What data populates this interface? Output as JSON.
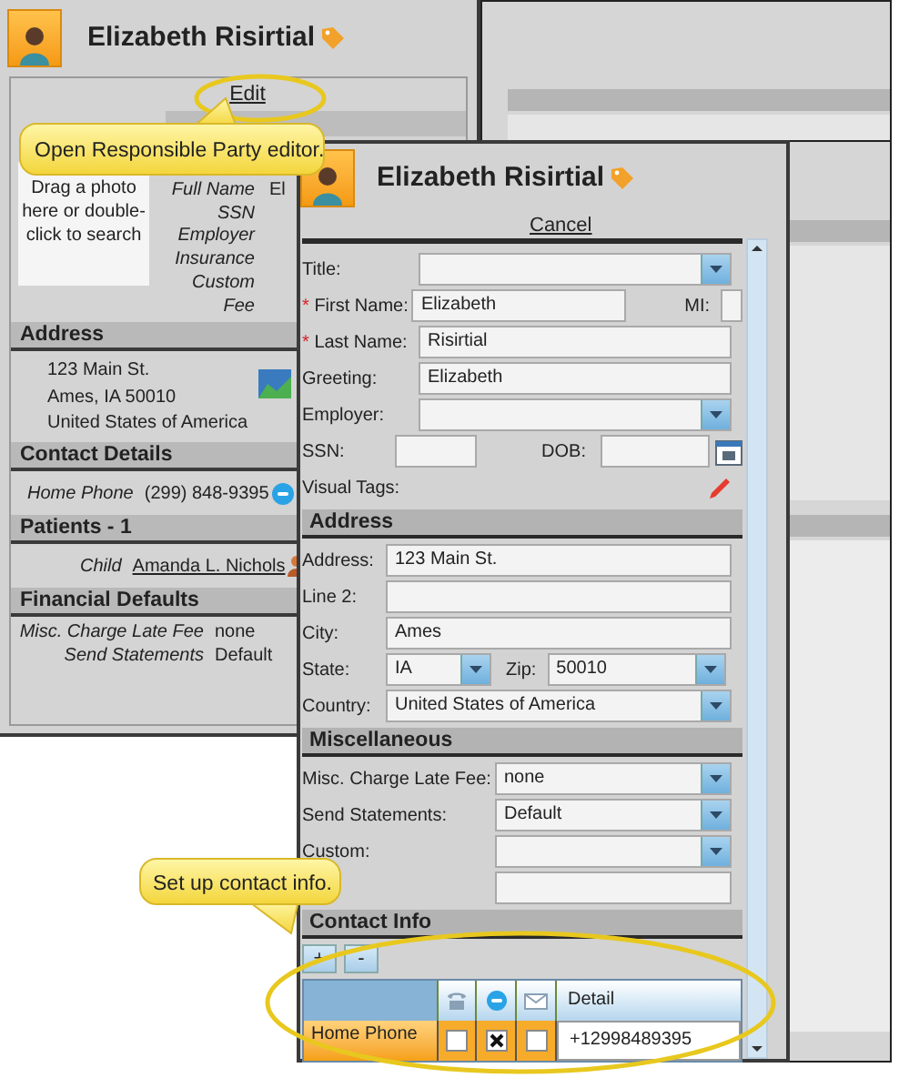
{
  "back_window": {
    "title": "Elizabeth Risirtial",
    "edit_link": "Edit",
    "photo_hint": "Drag a photo here or double-click to search",
    "bio_fields": [
      {
        "label": "Full Name",
        "value": "El"
      },
      {
        "label": "SSN"
      },
      {
        "label": "Employer"
      },
      {
        "label": "Insurance"
      },
      {
        "label": "Custom"
      },
      {
        "label": "Fee"
      }
    ],
    "sections": [
      {
        "kind": "address",
        "heading": "Address",
        "lines": [
          "123 Main St.",
          "Ames, IA 50010",
          "United States of America"
        ]
      },
      {
        "kind": "rows",
        "heading": "Contact Details",
        "rows": [
          {
            "kind": "phone",
            "label": "Home Phone",
            "value": "(299) 848-9395"
          }
        ]
      },
      {
        "kind": "rows",
        "heading": "Patients - 1",
        "rows": [
          {
            "kind": "patient",
            "label": "Child",
            "value": "Amanda L. Nichols"
          }
        ]
      },
      {
        "kind": "rows",
        "heading": "Financial Defaults",
        "rows": [
          {
            "kind": "plain",
            "label": "Misc. Charge Late Fee",
            "value": "none"
          },
          {
            "kind": "plain",
            "label": "Send Statements",
            "value": "Default"
          }
        ]
      }
    ]
  },
  "editor": {
    "title": "Elizabeth Risirtial",
    "cancel_link": "Cancel",
    "required_mark": "*",
    "biographical": [
      {
        "kind": "dropdown",
        "label": "Title:",
        "required": false
      },
      {
        "kind": "text",
        "label": "First Name:",
        "required": true,
        "value": "Elizabeth",
        "side": {
          "kind": "text",
          "label": "MI:"
        }
      },
      {
        "kind": "text",
        "label": "Last Name:",
        "required": true,
        "value": "Risirtial"
      },
      {
        "kind": "text",
        "label": "Greeting:",
        "required": false,
        "value": "Elizabeth"
      },
      {
        "kind": "dropdown",
        "label": "Employer:",
        "required": false
      },
      {
        "kind": "text",
        "label": "SSN:",
        "required": false,
        "side": {
          "kind": "date",
          "label": "DOB:"
        }
      },
      {
        "kind": "tags",
        "label": "Visual Tags:",
        "required": false
      }
    ],
    "address": {
      "heading": "Address",
      "rows": [
        {
          "kind": "text",
          "label": "Address:",
          "value": "123 Main St."
        },
        {
          "kind": "text",
          "label": "Line 2:"
        },
        {
          "kind": "text",
          "label": "City:",
          "value": "Ames"
        },
        {
          "kind": "dropdown",
          "label": "State:",
          "value": "IA",
          "side": {
            "kind": "dropdown",
            "label": "Zip:",
            "value": "50010"
          }
        },
        {
          "kind": "dropdown",
          "label": "Country:",
          "value": "United States of America"
        }
      ]
    },
    "miscellaneous": {
      "heading": "Miscellaneous",
      "rows": [
        {
          "kind": "dropdown",
          "label": "Misc. Charge Late Fee:",
          "value": "none"
        },
        {
          "kind": "dropdown",
          "label": "Send Statements:",
          "value": "Default"
        },
        {
          "kind": "dropdown",
          "label": "Custom:"
        },
        {
          "kind": "text"
        }
      ]
    },
    "contact_info": {
      "heading": "Contact Info",
      "add_button": "+",
      "remove_button": "-",
      "detail_column": "Detail",
      "rows": [
        {
          "name": "Home Phone",
          "selected": true,
          "checks": [
            false,
            true,
            false
          ],
          "detail": "+12998489395"
        }
      ]
    }
  },
  "callouts": [
    {
      "text": "Open Responsible Party editor."
    },
    {
      "text": "Set up contact info."
    }
  ]
}
